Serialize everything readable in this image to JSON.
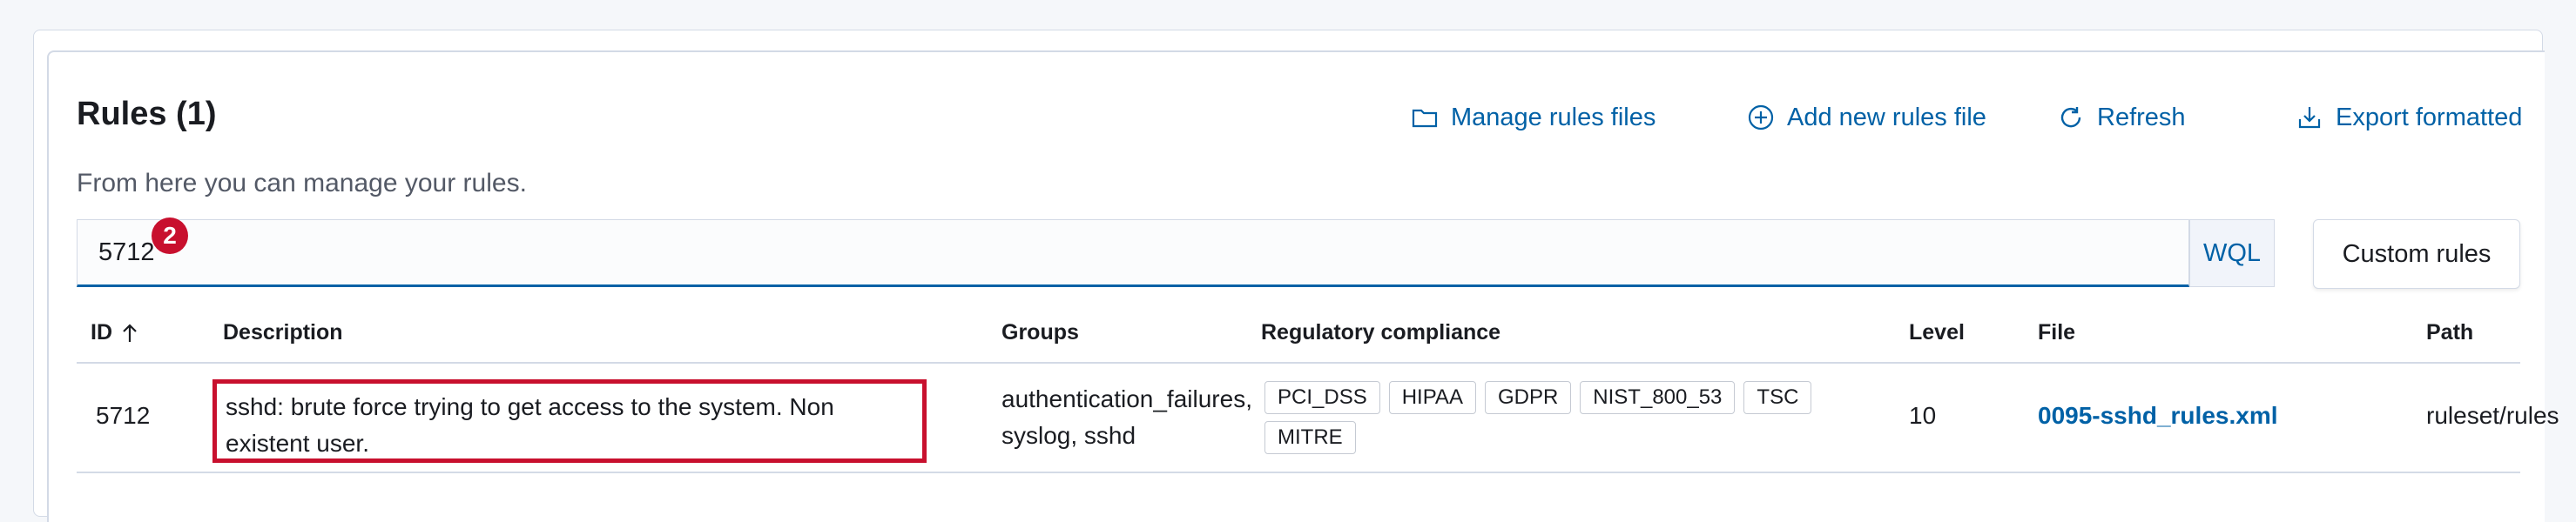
{
  "header": {
    "title": "Rules (1)",
    "subtitle": "From here you can manage your rules."
  },
  "actions": {
    "manage": "Manage rules files",
    "add": "Add new rules file",
    "refresh": "Refresh",
    "export": "Export formatted"
  },
  "search": {
    "value": "5712",
    "badge": "2",
    "wql": "WQL",
    "custom_rules": "Custom rules"
  },
  "table": {
    "columns": {
      "id": "ID",
      "description": "Description",
      "groups": "Groups",
      "compliance": "Regulatory compliance",
      "level": "Level",
      "file": "File",
      "path": "Path"
    },
    "row": {
      "id": "5712",
      "description": "sshd: brute force trying to get access to the system. Non existent user.",
      "groups": "authentication_failures, syslog, sshd",
      "compliance": [
        "PCI_DSS",
        "HIPAA",
        "GDPR",
        "NIST_800_53",
        "TSC",
        "MITRE"
      ],
      "level": "10",
      "file": "0095-sshd_rules.xml",
      "path": "ruleset/rules"
    }
  },
  "colors": {
    "accent": "#0061a6",
    "highlight": "#c8102e"
  }
}
